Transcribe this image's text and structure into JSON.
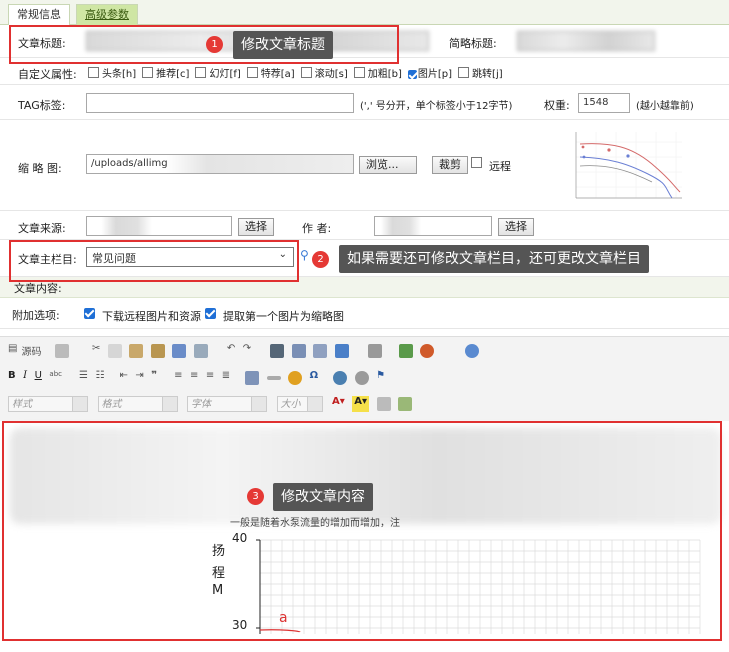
{
  "tabs": [
    "常规信息",
    "高级参数"
  ],
  "title_row": {
    "label": "文章标题:",
    "short_label": "简略标题:"
  },
  "custom_attr": {
    "label": "自定义属性:",
    "flags": [
      {
        "text": "头条[h]",
        "checked": false
      },
      {
        "text": "推荐[c]",
        "checked": false
      },
      {
        "text": "幻灯[f]",
        "checked": false
      },
      {
        "text": "特荐[a]",
        "checked": false
      },
      {
        "text": "滚动[s]",
        "checked": false
      },
      {
        "text": "加粗[b]",
        "checked": false
      },
      {
        "text": "图片[p]",
        "checked": true
      },
      {
        "text": "跳转[j]",
        "checked": false
      }
    ]
  },
  "tag_row": {
    "label": "TAG标签:",
    "hint": "(',' 号分开，单个标签小于12字节)",
    "weight_label": "权重:",
    "weight_value": "1548",
    "weight_hint": "(越小越靠前)"
  },
  "thumb_row": {
    "label": "缩 略 图:",
    "value": "/uploads/allimg",
    "browse": "浏览...",
    "crop": "裁剪",
    "remote": "远程"
  },
  "source_row": {
    "label": "文章来源:",
    "select_btn": "选择",
    "author_label": "作 者:",
    "author_btn": "选择"
  },
  "column_row": {
    "label": "文章主栏目:",
    "value": "常见问题"
  },
  "content_label": "文章内容:",
  "extra_row": {
    "label": "附加选项:",
    "opt1": "下载远程图片和资源",
    "opt2": "提取第一个图片为缩略图"
  },
  "editor": {
    "source_label": "源码",
    "styles": [
      "样式",
      "格式",
      "字体",
      "大小"
    ],
    "content_line": "一般是随着水泵流量的增加而增加，注",
    "chart": {
      "y_chars": [
        "扬",
        "程",
        "M"
      ],
      "y_top": "40",
      "y_bottom": "30",
      "curve_label": "a"
    }
  },
  "annotations": [
    {
      "num": "1",
      "text": "修改文章标题"
    },
    {
      "num": "2",
      "text": "如果需要还可修改文章栏目，还可更改文章栏目"
    },
    {
      "num": "3",
      "text": "修改文章内容"
    }
  ],
  "colors": {
    "annotation_red": "#e03030",
    "badge_red": "#e53935",
    "tip_bg": "#555555",
    "check_blue": "#1f6fd6"
  }
}
